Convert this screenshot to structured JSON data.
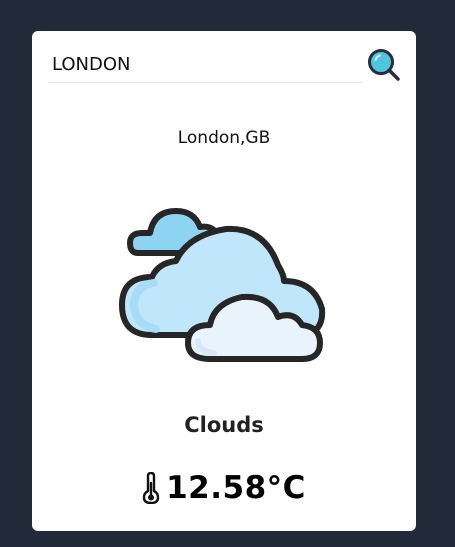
{
  "search": {
    "value": "LONDON",
    "button_icon": "search-icon"
  },
  "weather": {
    "location": "London,GB",
    "icon": "clouds-icon",
    "condition": "Clouds",
    "temperature_icon": "thermometer-icon",
    "temperature": "12.58°C"
  },
  "colors": {
    "background": "#222a3a",
    "card": "#ffffff",
    "search_lens": "#4fc6df",
    "cloud_outline": "#2b2b2b"
  }
}
